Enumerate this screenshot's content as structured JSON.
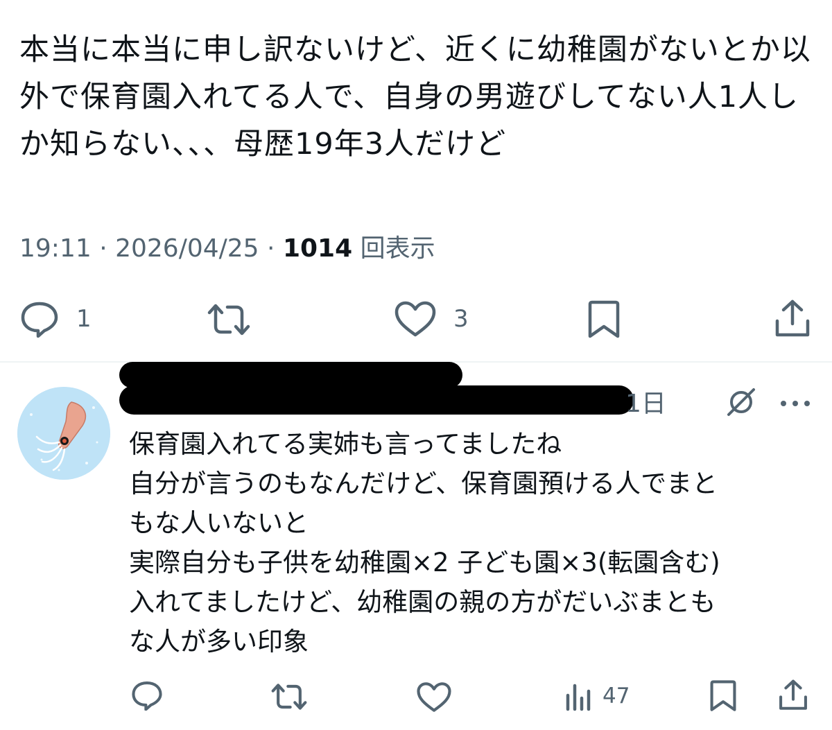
{
  "main_tweet": {
    "text": "本当に本当に申し訳ないけど、近くに幼稚園がないとか以外で保育園入れてる人で、自身の男遊びしてない人1人しか知らない、、、母歴19年3人だけど",
    "time": "19:11",
    "date": "2026/04/25",
    "views_count": "1014",
    "views_label": "回表示",
    "separator": " · ",
    "replies": "1",
    "likes": "3"
  },
  "reply": {
    "date_suffix": "1日",
    "text_lines": [
      "保育園入れてる実姉も言ってましたね",
      "自分が言うのもなんだけど、保育園預ける人でまと",
      "もな人いないと",
      "実際自分も子供を幼稚園×2 子ども園×3(転園含む)",
      "入れてましたけど、幼稚園の親の方がだいぶまとも",
      "な人が多い印象"
    ],
    "views": "47"
  },
  "colors": {
    "text": "#0f1419",
    "secondary": "#536471",
    "divider": "#eff3f4",
    "avatar_bg": "#bfe3f7",
    "redaction": "#000000"
  },
  "icons": {
    "reply": "reply-icon",
    "retweet": "retweet-icon",
    "like": "heart-icon",
    "bookmark": "bookmark-icon",
    "share": "share-icon",
    "views": "views-icon",
    "grok": "grok-icon",
    "more": "more-icon"
  }
}
